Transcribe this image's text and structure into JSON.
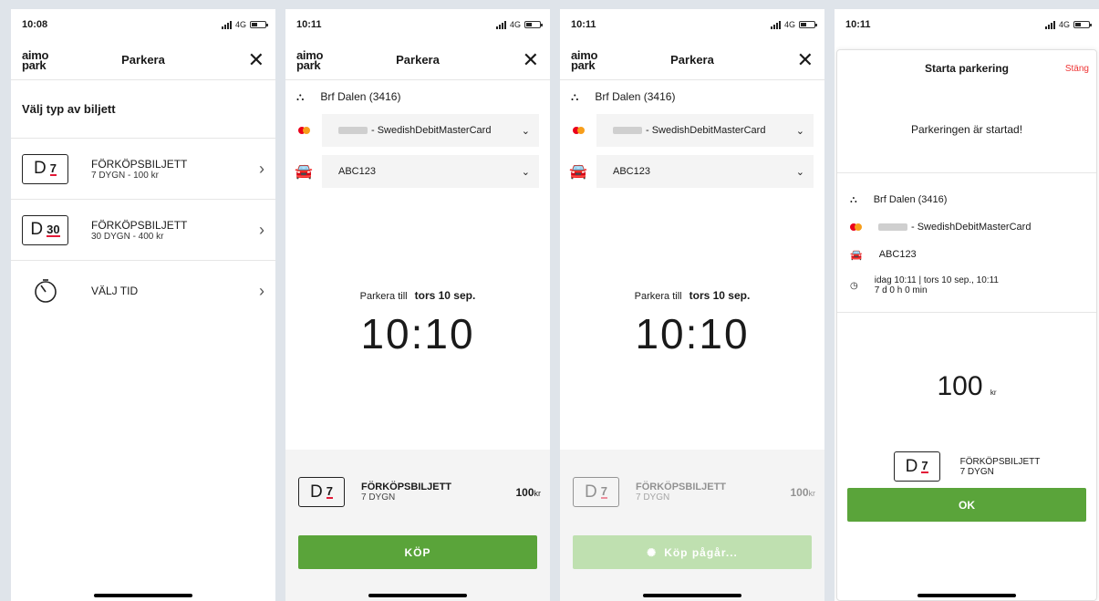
{
  "logo": [
    "aimo",
    "park"
  ],
  "screen1": {
    "time": "10:08",
    "network": "4G",
    "header_title": "Parkera",
    "section_title": "Välj typ av biljett",
    "options": [
      {
        "badge_letter": "D",
        "badge_num": "7",
        "name": "FÖRKÖPSBILJETT",
        "sub": "7 DYGN - 100 kr"
      },
      {
        "badge_letter": "D",
        "badge_num": "30",
        "name": "FÖRKÖPSBILJETT",
        "sub": "30 DYGN - 400 kr"
      },
      {
        "name": "VÄLJ TID",
        "icon": "timer-icon"
      }
    ]
  },
  "screen2": {
    "time": "10:11",
    "network": "4G",
    "header_title": "Parkera",
    "location": "Brf Dalen (3416)",
    "card": "- SwedishDebitMasterCard",
    "plate": "ABC123",
    "park_until_label": "Parkera till",
    "park_until_date": "tors 10 sep.",
    "park_until_time": "10:10",
    "ticket_badge": "D",
    "ticket_num": "7",
    "ticket_name": "FÖRKÖPSBILJETT",
    "ticket_sub": "7 DYGN",
    "price_value": "100",
    "price_unit": "kr",
    "buy_label": "KÖP"
  },
  "screen3": {
    "time": "10:11",
    "network": "4G",
    "header_title": "Parkera",
    "location": "Brf Dalen (3416)",
    "card": "- SwedishDebitMasterCard",
    "plate": "ABC123",
    "park_until_label": "Parkera till",
    "park_until_date": "tors 10 sep.",
    "park_until_time": "10:10",
    "ticket_badge": "D",
    "ticket_num": "7",
    "ticket_name": "FÖRKÖPSBILJETT",
    "ticket_sub": "7 DYGN",
    "price_value": "100",
    "price_unit": "kr",
    "buy_label": "Köp pågår..."
  },
  "screen4": {
    "time": "10:11",
    "network": "4G",
    "modal_title": "Starta parkering",
    "close_label": "Stäng",
    "started_text": "Parkeringen är startad!",
    "location": "Brf Dalen (3416)",
    "card": "- SwedishDebitMasterCard",
    "plate": "ABC123",
    "period_line1": "idag 10:11 | tors 10 sep., 10:11",
    "period_line2": "7 d 0 h 0 min",
    "price_value": "100",
    "price_unit": "kr",
    "ticket_badge": "D",
    "ticket_num": "7",
    "ticket_name": "FÖRKÖPSBILJETT",
    "ticket_sub": "7 DYGN",
    "ok_label": "OK"
  },
  "colors": {
    "accent_green": "#5aa43a",
    "accent_red": "#e31937",
    "background": "#dfe4ea"
  }
}
